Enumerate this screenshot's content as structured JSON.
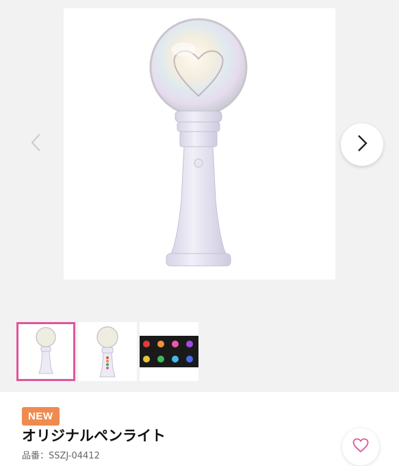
{
  "gallery": {
    "prev_icon": "chevron-left-icon",
    "next_icon": "chevron-right-icon",
    "main_image_alt": "ペンライト",
    "thumbnails": [
      {
        "name": "thumbnail-1",
        "selected": true
      },
      {
        "name": "thumbnail-2",
        "selected": false
      },
      {
        "name": "thumbnail-3",
        "selected": false
      }
    ]
  },
  "product": {
    "badge": "NEW",
    "title": "オリジナルペンライト",
    "sku_label": "品番：",
    "sku_value": "SSZJ-04412"
  },
  "favorite": {
    "icon": "heart-icon"
  },
  "colors": {
    "badge": "#ef8b4f",
    "selected_border": "#e0559a",
    "heart": "#e0559a"
  }
}
